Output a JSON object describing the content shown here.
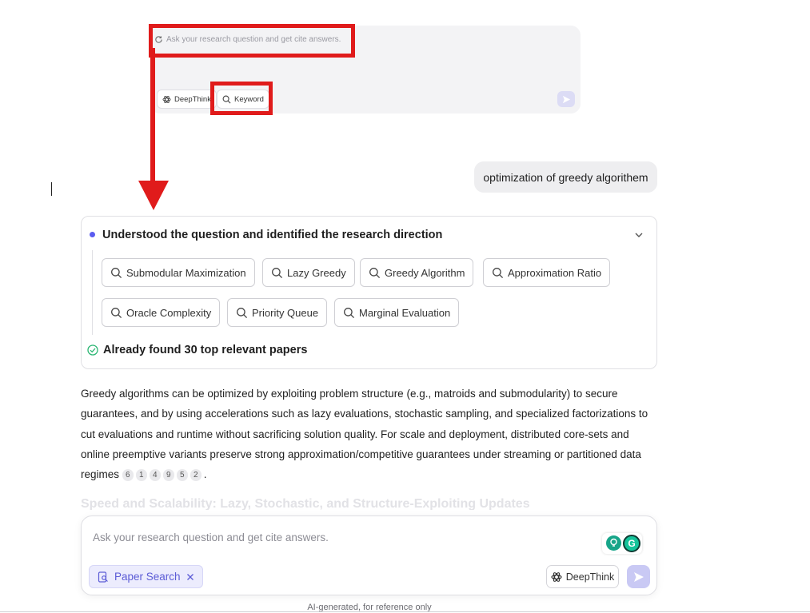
{
  "inset": {
    "placeholder": "Ask your research question and get cite answers.",
    "deepthink_label": "DeepThink",
    "keyword_label": "Keyword",
    "highlight_color": "#e01b1b"
  },
  "user_message": "optimization of greedy algorithem",
  "thinking": {
    "title": "Understood the question and identified the research direction",
    "keywords": [
      "Submodular Maximization",
      "Lazy Greedy",
      "Greedy Algorithm",
      "Approximation Ratio",
      "Oracle Complexity",
      "Priority Queue",
      "Marginal Evaluation"
    ],
    "found_text": "Already found 30 top relevant papers"
  },
  "answer": {
    "text": "Greedy algorithms can be optimized by exploiting problem structure (e.g., matroids and submodularity) to secure guarantees, and by using accelerations such as lazy evaluations, stochastic sampling, and specialized factorizations to cut evaluations and runtime without sacrificing solution quality. For scale and deployment, distributed core-sets and online preemptive variants preserve strong approximation/competitive guarantees under streaming or partitioned data regimes",
    "citations": [
      "6",
      "1",
      "4",
      "9",
      "5",
      "2"
    ],
    "next_heading": "Speed and Scalability: Lazy, Stochastic, and Structure-Exploiting Updates"
  },
  "composer": {
    "placeholder": "Ask your research question and get cite answers.",
    "paper_search_label": "Paper Search",
    "deepthink_label": "DeepThink"
  },
  "disclaimer": "AI-generated, for reference only",
  "colors": {
    "accent": "#5b5cf0",
    "success": "#2bb673",
    "annotation_red": "#e01b1b"
  }
}
